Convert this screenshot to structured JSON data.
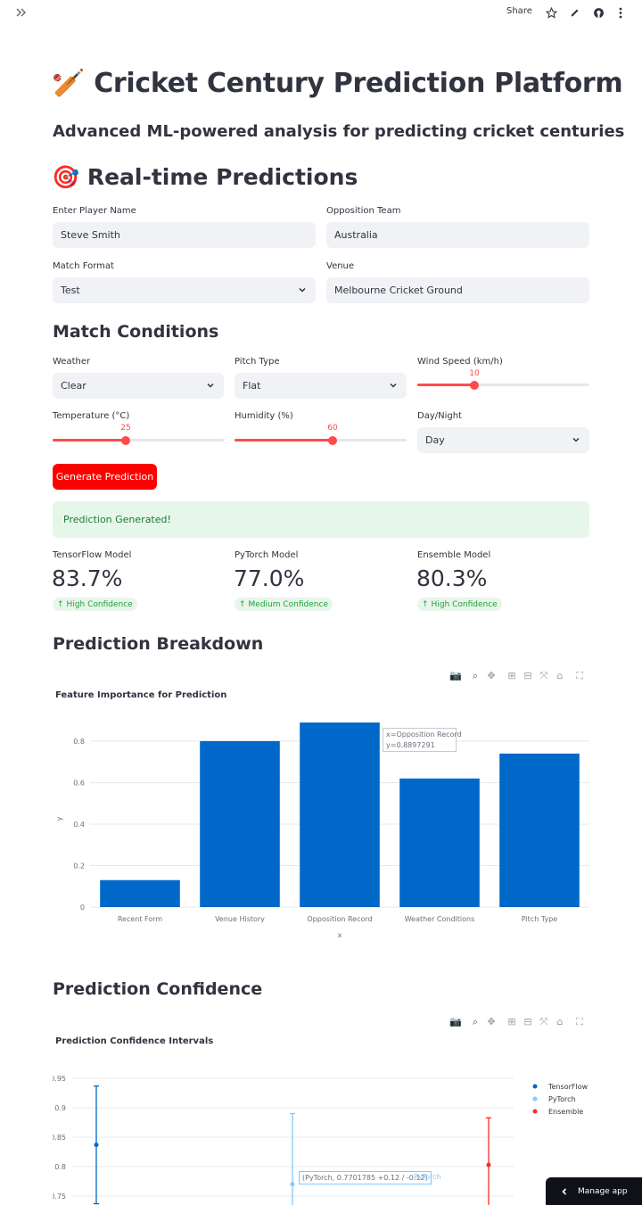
{
  "header": {
    "share_label": "Share",
    "icons": [
      "sidebar-expand-icon",
      "star-icon",
      "pencil-icon",
      "github-icon",
      "kebab-menu-icon"
    ]
  },
  "page": {
    "title": "🏏 Cricket Century Prediction Platform",
    "subtitle": "Advanced ML-powered analysis for predicting cricket centuries",
    "realtime_heading": "🎯 Real-time Predictions"
  },
  "form": {
    "player_label": "Enter Player Name",
    "player_value": "Steve Smith",
    "opposition_label": "Opposition Team",
    "opposition_value": "Australia",
    "format_label": "Match Format",
    "format_value": "Test",
    "venue_label": "Venue",
    "venue_value": "Melbourne Cricket Ground"
  },
  "conditions": {
    "heading": "Match Conditions",
    "weather_label": "Weather",
    "weather_value": "Clear",
    "pitch_label": "Pitch Type",
    "pitch_value": "Flat",
    "wind_label": "Wind Speed (km/h)",
    "wind_value": "10",
    "wind_fraction": 0.38,
    "temp_label": "Temperature (°C)",
    "temp_value": "25",
    "temp_fraction": 0.43,
    "humidity_label": "Humidity (%)",
    "humidity_value": "60",
    "humidity_fraction": 0.57,
    "daynight_label": "Day/Night",
    "daynight_value": "Day"
  },
  "actions": {
    "generate_label": "Generate Prediction",
    "success_message": "Prediction Generated!"
  },
  "metrics": [
    {
      "label": "TensorFlow Model",
      "value": "83.7%",
      "delta": "High Confidence"
    },
    {
      "label": "PyTorch Model",
      "value": "77.0%",
      "delta": "Medium Confidence"
    },
    {
      "label": "Ensemble Model",
      "value": "80.3%",
      "delta": "High Confidence"
    }
  ],
  "breakdown": {
    "heading": "Prediction Breakdown",
    "tooltip_line1": "x=Opposition Record",
    "tooltip_line2": "y=0.8897291"
  },
  "confidence": {
    "heading": "Prediction Confidence",
    "hover_label": "(PyTorch, 0.7701785 +0.12 / -0.12)",
    "hover_series": "PyTorch"
  },
  "footer": {
    "manage_label": "Manage app"
  },
  "colors": {
    "accent": "#ff4b4b",
    "bar": "#0068c9",
    "tensorflow": "#0068c9",
    "pytorch": "#83c9ff",
    "ensemble": "#ff2b2b"
  },
  "chart_data": [
    {
      "type": "bar",
      "title": "Feature Importance for Prediction",
      "xlabel": "x",
      "ylabel": "y",
      "categories": [
        "Recent Form",
        "Venue History",
        "Opposition Record",
        "Weather Conditions",
        "Pitch Type"
      ],
      "values": [
        0.13,
        0.8,
        0.8897291,
        0.62,
        0.74
      ],
      "ylim": [
        0,
        0.89
      ],
      "yticks": [
        0,
        0.2,
        0.4,
        0.6,
        0.8
      ],
      "grid": true
    },
    {
      "type": "scatter",
      "title": "Prediction Confidence Intervals",
      "categories": [
        "TensorFlow",
        "PyTorch",
        "Ensemble"
      ],
      "series": [
        {
          "name": "TensorFlow",
          "value": 0.837,
          "error": 0.1
        },
        {
          "name": "PyTorch",
          "value": 0.7701785,
          "error": 0.12
        },
        {
          "name": "Ensemble",
          "value": 0.803,
          "error": 0.08
        }
      ],
      "ylim": [
        0.74,
        0.96
      ],
      "yticks": [
        0.75,
        0.8,
        0.85,
        0.9,
        0.95
      ],
      "legend": "top-right",
      "grid": true
    }
  ]
}
